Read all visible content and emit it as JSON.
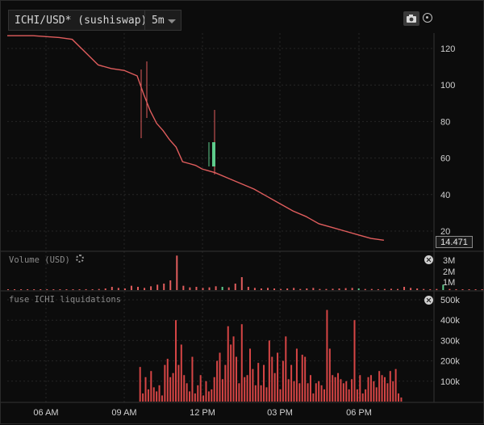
{
  "toolbar": {
    "pair_label": "ICHI/USD* (sushiswap)",
    "timeframe": "5m"
  },
  "price_pane": {
    "y_ticks": [
      "120",
      "100",
      "80",
      "60",
      "40",
      "20"
    ],
    "last_price": "14.471"
  },
  "volume_pane": {
    "title": "Volume (USD)",
    "y_ticks": [
      "3M",
      "2M",
      "1M"
    ]
  },
  "liq_pane": {
    "title": "fuse ICHI liquidations",
    "y_ticks": [
      "500k",
      "400k",
      "300k",
      "200k",
      "100k"
    ]
  },
  "x_ticks": [
    "06 AM",
    "09 AM",
    "12 PM",
    "03 PM",
    "06 PM"
  ],
  "colors": {
    "up": "#5ecb8c",
    "down": "#e05d5d",
    "bar": "#d64545",
    "grid": "#262626"
  },
  "icons": {
    "camera": "camera-icon",
    "target": "target-icon",
    "gear": "gear-icon",
    "close": "close-icon"
  },
  "chart_data": [
    {
      "type": "line",
      "title": "ICHI/USD* (sushiswap)",
      "x": [
        "05:00",
        "06:00",
        "07:00",
        "07:30",
        "08:00",
        "08:30",
        "09:00",
        "09:30",
        "10:00",
        "10:15",
        "10:30",
        "10:45",
        "11:00",
        "11:15",
        "11:30",
        "11:45",
        "12:00",
        "12:15",
        "12:30",
        "13:00",
        "13:30",
        "14:00",
        "14:30",
        "15:00",
        "15:30",
        "16:00",
        "16:30",
        "17:00",
        "17:30",
        "18:00",
        "18:30",
        "19:00",
        "19:30"
      ],
      "series": [
        {
          "values": [
            127,
            127,
            126,
            125,
            118,
            111,
            109,
            108,
            105,
            95,
            86,
            79,
            75,
            70,
            66,
            58,
            57,
            56,
            54,
            52,
            49,
            46,
            43,
            39,
            35,
            31,
            28,
            24,
            22,
            20,
            18,
            16,
            15
          ]
        }
      ],
      "ylim": [
        10,
        130
      ],
      "last": 14.471
    },
    {
      "type": "bar",
      "title": "Volume (USD)",
      "x_start": "05:00",
      "interval_minutes": 15,
      "values": [
        0.05,
        0.04,
        0.03,
        0.05,
        0.06,
        0.04,
        0.03,
        0.02,
        0.03,
        0.04,
        0.05,
        0.06,
        0.08,
        0.05,
        0.1,
        0.15,
        0.3,
        0.2,
        0.15,
        0.4,
        0.3,
        0.2,
        0.35,
        0.5,
        0.6,
        0.9,
        3.2,
        0.4,
        0.25,
        0.3,
        0.2,
        0.25,
        0.35,
        0.3,
        0.25,
        0.6,
        1.2,
        0.3,
        0.2,
        0.15,
        0.2,
        0.15,
        0.1,
        0.15,
        0.2,
        0.1,
        0.15,
        0.2,
        0.1,
        0.1,
        0.12,
        0.15,
        0.18,
        0.2,
        0.15,
        0.1,
        0.1,
        0.08,
        0.1,
        0.12,
        0.1,
        0.3,
        0.2,
        0.15,
        0.1,
        0.08,
        0.1,
        0.5,
        0.1,
        0.08,
        0.05,
        0.06,
        0.05,
        0.04,
        0.03,
        0.04,
        0.03,
        0.02,
        0.03,
        0.02
      ],
      "ylim": [
        0,
        3.5
      ]
    },
    {
      "type": "bar",
      "title": "fuse ICHI liquidations",
      "x_start": "10:05",
      "interval_minutes": 5,
      "values": [
        170,
        40,
        120,
        60,
        150,
        70,
        50,
        80,
        30,
        180,
        210,
        120,
        140,
        400,
        180,
        280,
        130,
        90,
        50,
        220,
        40,
        80,
        130,
        30,
        100,
        50,
        60,
        120,
        200,
        240,
        110,
        180,
        370,
        280,
        320,
        220,
        90,
        380,
        120,
        130,
        260,
        160,
        80,
        190,
        80,
        180,
        70,
        300,
        220,
        140,
        240,
        60,
        200,
        320,
        110,
        180,
        100,
        260,
        90,
        230,
        220,
        90,
        130,
        40,
        90,
        100,
        80,
        60,
        450,
        260,
        130,
        120,
        140,
        110,
        90,
        100,
        60,
        110,
        400,
        60,
        130,
        40,
        60,
        120,
        130,
        100,
        70,
        150,
        130,
        120,
        90,
        150,
        100,
        160,
        40,
        20
      ],
      "ylim": [
        0,
        550
      ]
    }
  ]
}
